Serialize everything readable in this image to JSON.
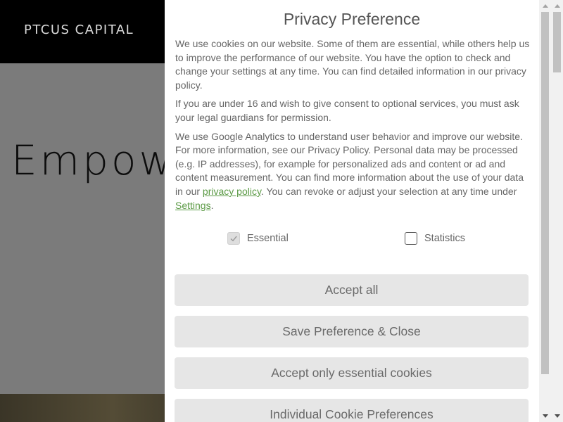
{
  "site": {
    "logo": "PTCUS CAPITAL",
    "hero_title": "Empow"
  },
  "modal": {
    "title": "Privacy Preference",
    "paragraph1": "We use cookies on our website. Some of them are essential, while others help us to improve the performance of our website. You have the option to check and change your settings at any time. You can find detailed information in our privacy policy.",
    "paragraph2": "If you are under 16 and wish to give consent to optional services, you must ask your legal guardians for permission.",
    "paragraph3_part1": "We use Google Analytics to understand user behavior and improve our website. For more information, see our Privacy Policy. Personal data may be processed (e.g. IP addresses), for example for personalized ads and content or ad and content measurement. You can find more information about the use of your data in our ",
    "privacy_link": "privacy policy",
    "paragraph3_part2": ". You can revoke or adjust your selection at any time under ",
    "settings_link": "Settings",
    "paragraph3_part3": ".",
    "options": {
      "essential_label": "Essential",
      "essential_checked": true,
      "essential_disabled": true,
      "statistics_label": "Statistics",
      "statistics_checked": false
    },
    "buttons": {
      "accept_all": "Accept all",
      "save_close": "Save Preference & Close",
      "essential_only": "Accept only essential cookies",
      "individual": "Individual Cookie Preferences"
    }
  },
  "colors": {
    "link": "#5b9a45",
    "button_bg": "#e6e6e6",
    "hero_bg": "#7b7b7b",
    "header_bg": "#000000"
  }
}
